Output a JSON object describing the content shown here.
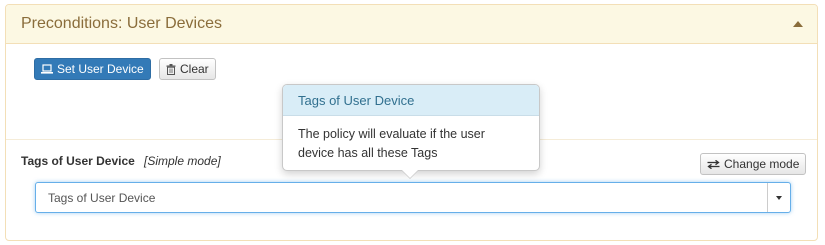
{
  "panel": {
    "title": "Preconditions: User Devices"
  },
  "toolbar": {
    "set_device_label": "Set User Device",
    "clear_label": "Clear"
  },
  "field": {
    "label": "Tags of User Device",
    "mode": "[Simple mode]",
    "change_mode_label": "Change mode",
    "select_placeholder": "Tags of User Device"
  },
  "popover": {
    "title": "Tags of User Device",
    "line1": "The policy will evaluate if the user",
    "line2": "device has all these Tags"
  },
  "icons": {
    "set_device": "laptop-icon",
    "clear": "trash-icon",
    "change_mode": "swap-icon",
    "collapse": "caret-up-icon",
    "dropdown": "caret-down-icon"
  },
  "colors": {
    "panel_heading_bg": "#fcf8e3",
    "panel_heading_text": "#8a6d3b",
    "primary": "#337ab7",
    "popover_title_bg": "#d9edf7",
    "popover_title_text": "#31708f",
    "focus_border": "#66afe9"
  }
}
